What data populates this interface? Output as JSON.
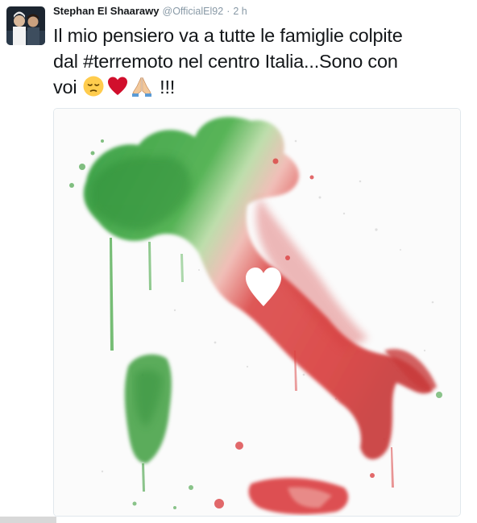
{
  "tweet": {
    "author_name": "Stephan El Shaarawy",
    "handle": "@OfficialEl92",
    "separator": "·",
    "time": "2 h",
    "text_line1": "Il mio pensiero va a tutte le famiglie colpite",
    "text_line2_prefix": "dal ",
    "hashtag": "#terremoto",
    "text_line2_suffix": " nel centro Italia...Sono con",
    "text_line3_prefix": "voi ",
    "text_line3_suffix": " !!!",
    "emojis": [
      "pensive-face-emoji",
      "red-heart-emoji",
      "folded-hands-emoji"
    ]
  },
  "media": {
    "subject": "watercolor-italy-map-with-heart",
    "colors": {
      "green": "#3a9b3a",
      "light_green": "#8fcf7a",
      "red": "#d9383a",
      "pink": "#e88a8a",
      "heart": "#ffffff"
    }
  },
  "colors": {
    "text": "#14171a",
    "muted": "#8899a6",
    "border": "#e1e8ed"
  }
}
